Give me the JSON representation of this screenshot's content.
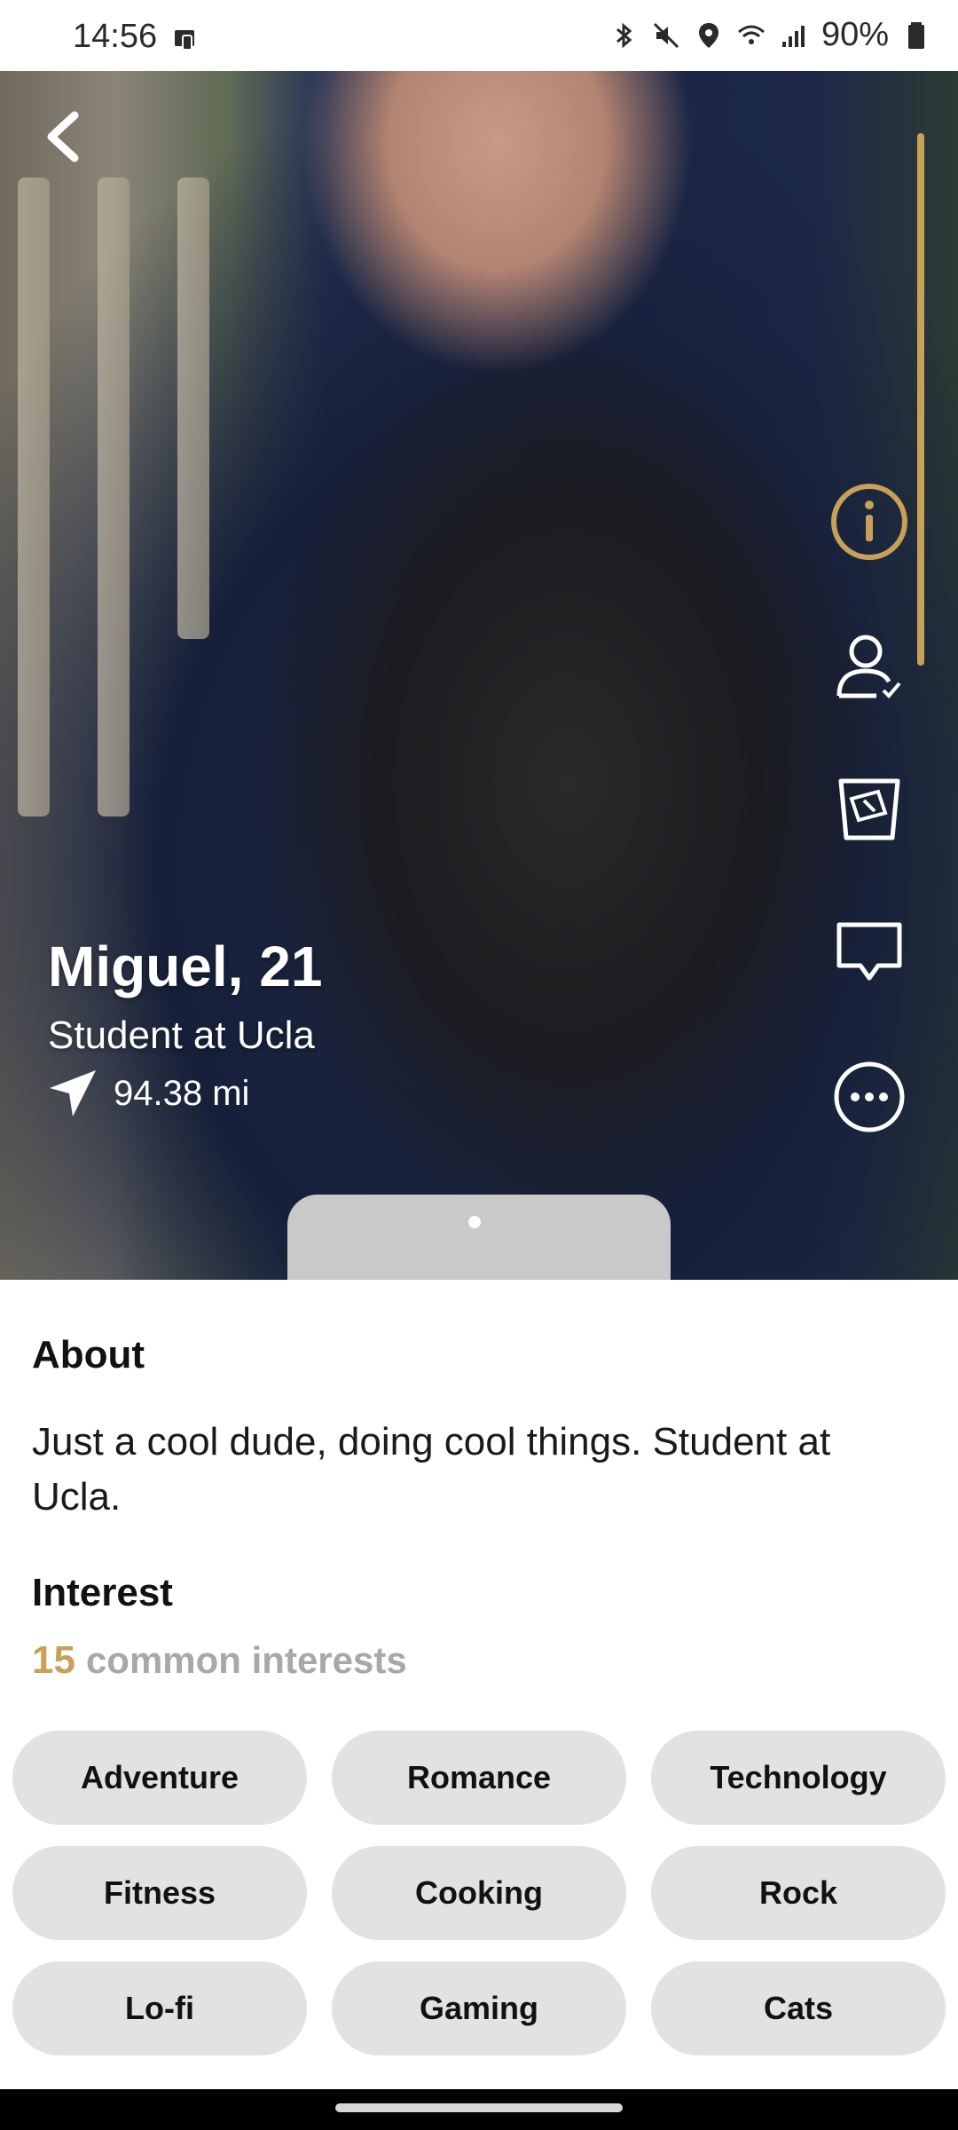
{
  "status_bar": {
    "time": "14:56",
    "battery": "90%",
    "icons": [
      "device-icon",
      "bluetooth-icon",
      "mute-icon",
      "location-icon",
      "wifi-icon",
      "signal-icon",
      "battery-icon"
    ]
  },
  "profile": {
    "name_age": "Miguel, 21",
    "occupation": "Student at Ucla",
    "distance": "94.38 mi"
  },
  "actions": [
    {
      "name": "info-icon",
      "color": "#c8a058"
    },
    {
      "name": "verified-user-icon"
    },
    {
      "name": "drink-icon"
    },
    {
      "name": "chat-bubble-icon"
    },
    {
      "name": "more-options-icon"
    }
  ],
  "about": {
    "title": "About",
    "text": "Just a cool dude, doing cool things. Student at Ucla."
  },
  "interest": {
    "title": "Interest",
    "count": "15",
    "common_label": "common interests",
    "chips": [
      "Adventure",
      "Romance",
      "Technology",
      "Fitness",
      "Cooking",
      "Rock",
      "Lo-fi",
      "Gaming",
      "Cats"
    ]
  },
  "colors": {
    "accent_gold": "#c8a058",
    "chip_bg": "#e2e2e2"
  }
}
